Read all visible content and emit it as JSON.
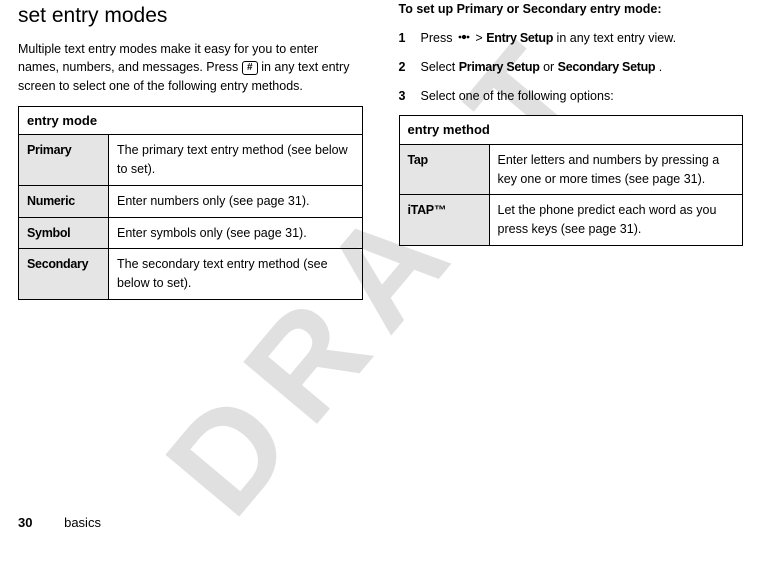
{
  "left": {
    "heading": "set entry modes",
    "intro_pre": "Multiple text entry modes make it easy for you to enter names, numbers, and messages. Press ",
    "intro_key": "#",
    "intro_post": " in any text entry screen to select one of the following entry methods.",
    "table_header": "entry mode",
    "rows": [
      {
        "name": "Primary",
        "desc": "The primary text entry method (see below to set)."
      },
      {
        "name": "Numeric",
        "desc": "Enter numbers only (see page 31)."
      },
      {
        "name": "Symbol",
        "desc": "Enter symbols only (see page 31)."
      },
      {
        "name": "Secondary",
        "desc": "The secondary text entry method (see below to set)."
      }
    ]
  },
  "right": {
    "subtitle": "To set up Primary or Secondary entry mode:",
    "steps": {
      "s1_pre": "Press ",
      "s1_mid": " > ",
      "s1_menu": "Entry Setup",
      "s1_post": " in any text entry view.",
      "s2_pre": "Select ",
      "s2_a": "Primary Setup",
      "s2_or": " or ",
      "s2_b": "Secondary Setup",
      "s2_post": ".",
      "s3": "Select one of the following options:"
    },
    "table_header": "entry method",
    "rows": [
      {
        "name": "Tap",
        "desc": "Enter letters and numbers by pressing a key one or more times (see page 31)."
      },
      {
        "name": "iTAP™",
        "desc": "Let the phone predict each word as you press keys (see page 31)."
      }
    ]
  },
  "footer": {
    "page": "30",
    "section": "basics"
  },
  "watermark": "DRAFT"
}
